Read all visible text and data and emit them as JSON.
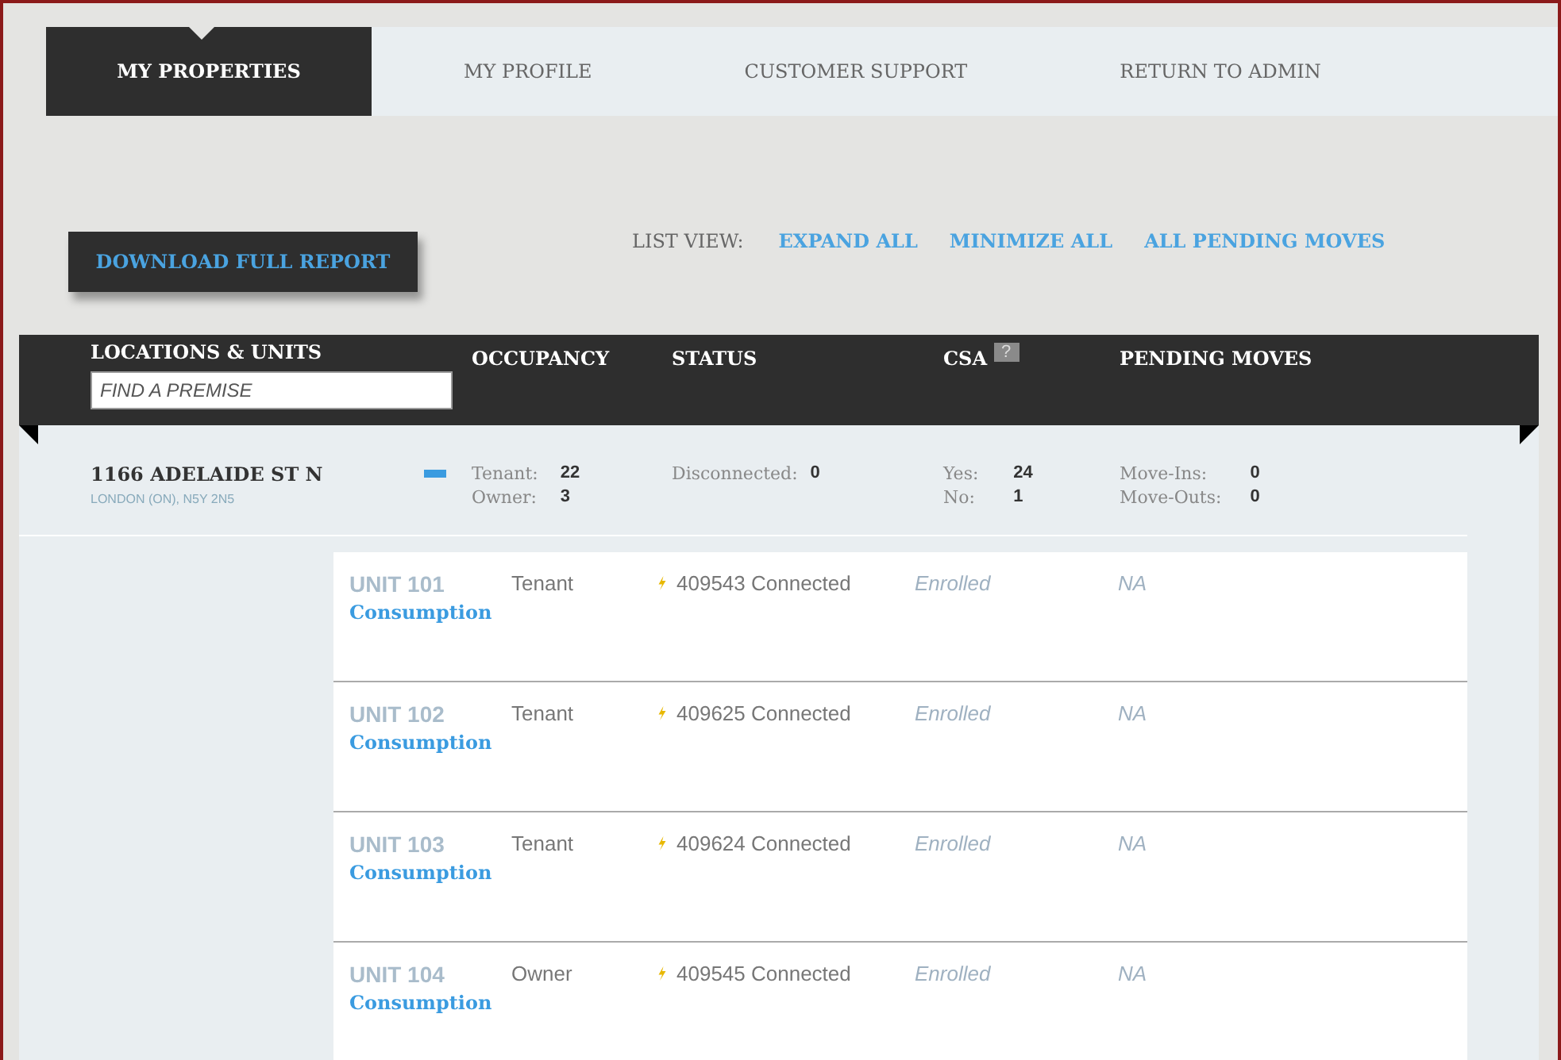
{
  "tabs": [
    {
      "label": "MY PROPERTIES",
      "selected": true
    },
    {
      "label": "MY PROFILE",
      "selected": false
    },
    {
      "label": "CUSTOMER SUPPORT",
      "selected": false
    },
    {
      "label": "RETURN TO ADMIN",
      "selected": false
    }
  ],
  "download_button": "DOWNLOAD FULL REPORT",
  "list_view": {
    "label": "LIST VIEW:",
    "links": [
      "EXPAND ALL",
      "MINIMIZE ALL",
      "ALL PENDING MOVES"
    ]
  },
  "table": {
    "columns": [
      "LOCATIONS & UNITS",
      "OCCUPANCY",
      "STATUS",
      "CSA",
      "PENDING MOVES"
    ],
    "csa_help": "?",
    "search": {
      "placeholder": "FIND A PREMISE"
    },
    "property": {
      "name": "1166 ADELAIDE ST N",
      "address": "LONDON (ON), N5Y 2N5",
      "expanded": true,
      "occupancy": [
        {
          "label": "Tenant:",
          "value": "22"
        },
        {
          "label": "Owner:",
          "value": "3"
        }
      ],
      "status": [
        {
          "label": "Disconnected:",
          "value": "0"
        }
      ],
      "csa": [
        {
          "label": "Yes:",
          "value": "24"
        },
        {
          "label": "No:",
          "value": "1"
        }
      ],
      "pending": [
        {
          "label": "Move-Ins:",
          "value": "0"
        },
        {
          "label": "Move-Outs:",
          "value": "0"
        }
      ]
    },
    "units": [
      {
        "name": "UNIT 101",
        "link": "Consumption",
        "occupancy": "Tenant",
        "status": "409543 Connected",
        "csa": "Enrolled",
        "pending": "NA"
      },
      {
        "name": "UNIT 102",
        "link": "Consumption",
        "occupancy": "Tenant",
        "status": "409625 Connected",
        "csa": "Enrolled",
        "pending": "NA"
      },
      {
        "name": "UNIT 103",
        "link": "Consumption",
        "occupancy": "Tenant",
        "status": "409624 Connected",
        "csa": "Enrolled",
        "pending": "NA"
      },
      {
        "name": "UNIT 104",
        "link": "Consumption",
        "occupancy": "Owner",
        "status": "409545 Connected",
        "csa": "Enrolled",
        "pending": "NA"
      }
    ]
  }
}
